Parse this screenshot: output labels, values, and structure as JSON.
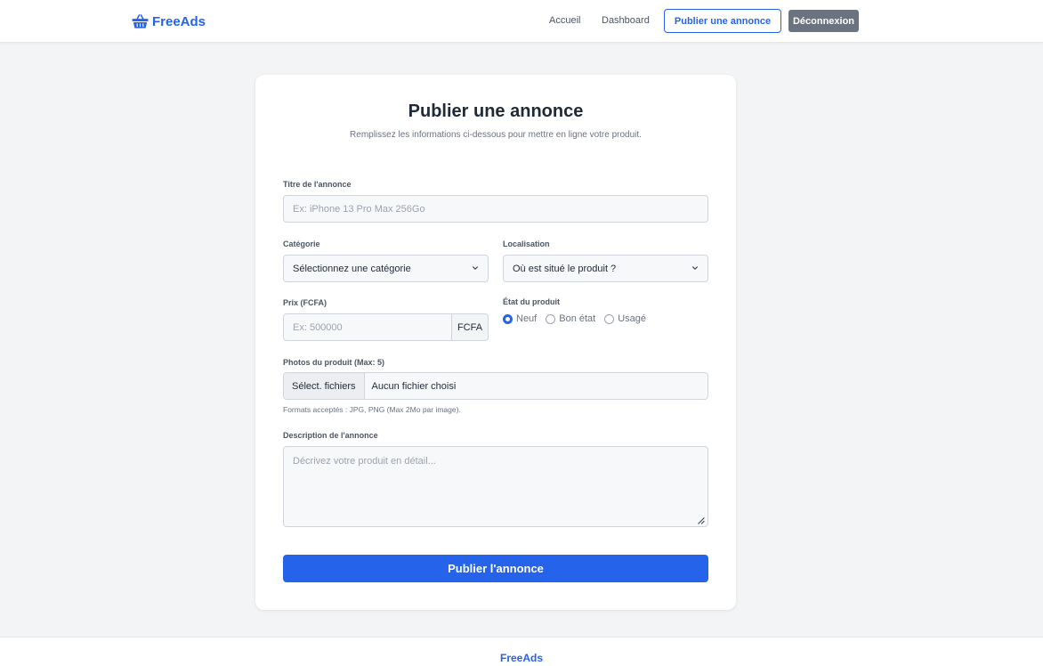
{
  "header": {
    "brand": "FreeAds",
    "nav": {
      "home": "Accueil",
      "dashboard": "Dashboard",
      "publish": "Publier une annonce",
      "logout": "Déconnexion"
    }
  },
  "form": {
    "title": "Publier une annonce",
    "subtitle": "Remplissez les informations ci-dessous pour mettre en ligne votre produit.",
    "ad_title": {
      "label": "Titre de l'annonce",
      "placeholder": "Ex: iPhone 13 Pro Max 256Go"
    },
    "category": {
      "label": "Catégorie",
      "selected": "Sélectionnez une catégorie"
    },
    "location": {
      "label": "Localisation",
      "selected": "Où est situé le produit ?"
    },
    "price": {
      "label": "Prix (FCFA)",
      "placeholder": "Ex: 500000",
      "currency": "FCFA"
    },
    "condition": {
      "label": "État du produit",
      "options": [
        "Neuf",
        "Bon état",
        "Usagé"
      ],
      "selected": "Neuf"
    },
    "photos": {
      "label": "Photos du produit (Max: 5)",
      "button": "Sélect. fichiers",
      "status": "Aucun fichier choisi",
      "help": "Formats acceptés : JPG, PNG (Max 2Mo par image)."
    },
    "description": {
      "label": "Description de l'annonce",
      "placeholder": "Décrivez votre produit en détail..."
    },
    "submit": "Publier l'annonce"
  },
  "footer": {
    "brand": "FreeAds"
  },
  "colors": {
    "primary": "#2563eb",
    "secondary": "#6b7280",
    "background": "#f3f4f6"
  }
}
